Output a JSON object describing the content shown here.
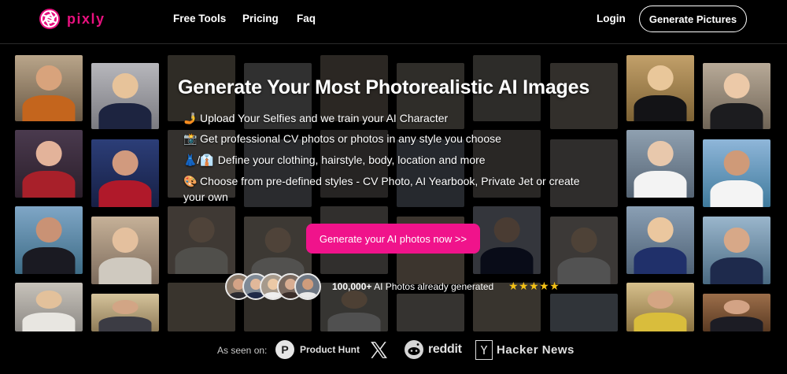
{
  "brand": {
    "name": "pixly",
    "logo_icon": "aperture-icon",
    "accent": "#e8117f"
  },
  "nav": {
    "links": [
      "Free Tools",
      "Pricing",
      "Faq"
    ],
    "login": "Login",
    "cta": "Generate Pictures"
  },
  "hero": {
    "title": "Generate Your Most Photorealistic AI Images",
    "features": [
      {
        "icon": "🤳",
        "text": "Upload Your Selfies and we train your AI Character"
      },
      {
        "icon": "📸",
        "text": "Get professional CV photos or photos in any style you choose"
      },
      {
        "icon": "👗/👔",
        "text": "Define your clothing, hairstyle, body, location and more"
      },
      {
        "icon": "🎨",
        "text": "Choose from pre-defined styles - CV Photo, AI Yearbook, Private Jet or create your own"
      }
    ],
    "cta": "Generate your AI photos now >>",
    "social_proof": {
      "count": "100,000+",
      "text": " AI Photos already generated",
      "stars": "★★★★★"
    }
  },
  "as_seen_on": {
    "label": "As seen on:",
    "outlets": [
      "Product Hunt",
      "X",
      "reddit",
      "Hacker News"
    ]
  }
}
